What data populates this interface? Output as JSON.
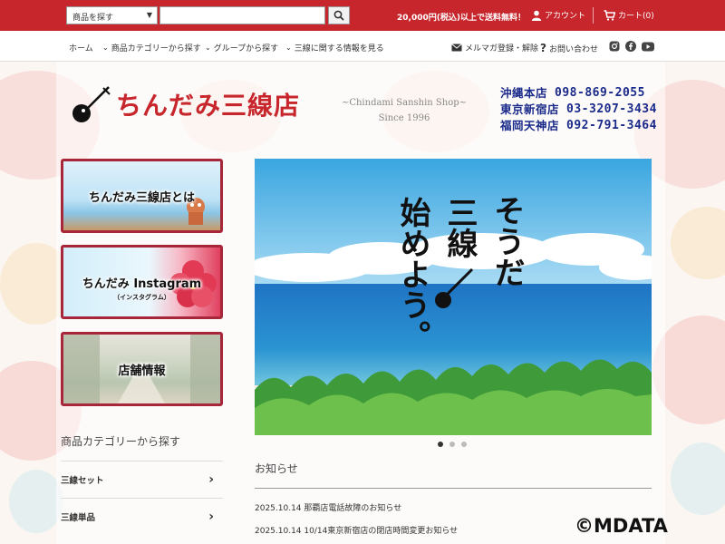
{
  "topbar": {
    "search_category": "商品を探す",
    "search_value": "",
    "free_shipping": "20,000円(税込)以上で送料無料！",
    "account": "アカウント",
    "cart": "カート(0)"
  },
  "nav": {
    "items": [
      "ホーム",
      "商品カテゴリーから探す",
      "グループから探す",
      "三線に関する情報を見る"
    ],
    "newsletter": "メルマガ登録・解除",
    "contact": "お問い合わせ",
    "social_icons": [
      "instagram-icon",
      "facebook-icon",
      "youtube-icon"
    ]
  },
  "header": {
    "logo_text": "ちんだみ三線店",
    "tagline_1": "~Chindami Sanshin Shop~",
    "tagline_2": "Since 1996",
    "phones": [
      {
        "store": "沖縄本店",
        "number": "098-869-2055"
      },
      {
        "store": "東京新宿店",
        "number": "03-3207-3434"
      },
      {
        "store": "福岡天神店",
        "number": "092-791-3464"
      }
    ]
  },
  "sidebar": {
    "banners": [
      {
        "label": "ちんだみ三線店とは"
      },
      {
        "label": "ちんだみ Instagram",
        "sub": "（インスタグラム）"
      },
      {
        "label": "店舗情報"
      }
    ],
    "category_title": "商品カテゴリーから探す",
    "categories": [
      "三線セット",
      "三線単品"
    ]
  },
  "hero": {
    "line1": "そうだ",
    "line2": "三線",
    "line3": "始めよう。"
  },
  "slider": {
    "count": 3,
    "active": 0
  },
  "news": {
    "title": "お知らせ",
    "items": [
      "2025.10.14 那覇店電話故障のお知らせ",
      "2025.10.14 10/14東京新宿店の閉店時間変更お知らせ"
    ]
  },
  "copyright": "©MDATA",
  "colors": {
    "brand_red": "#c8262d",
    "phone_blue": "#1a2a8a",
    "banner_border": "#a8263a"
  }
}
